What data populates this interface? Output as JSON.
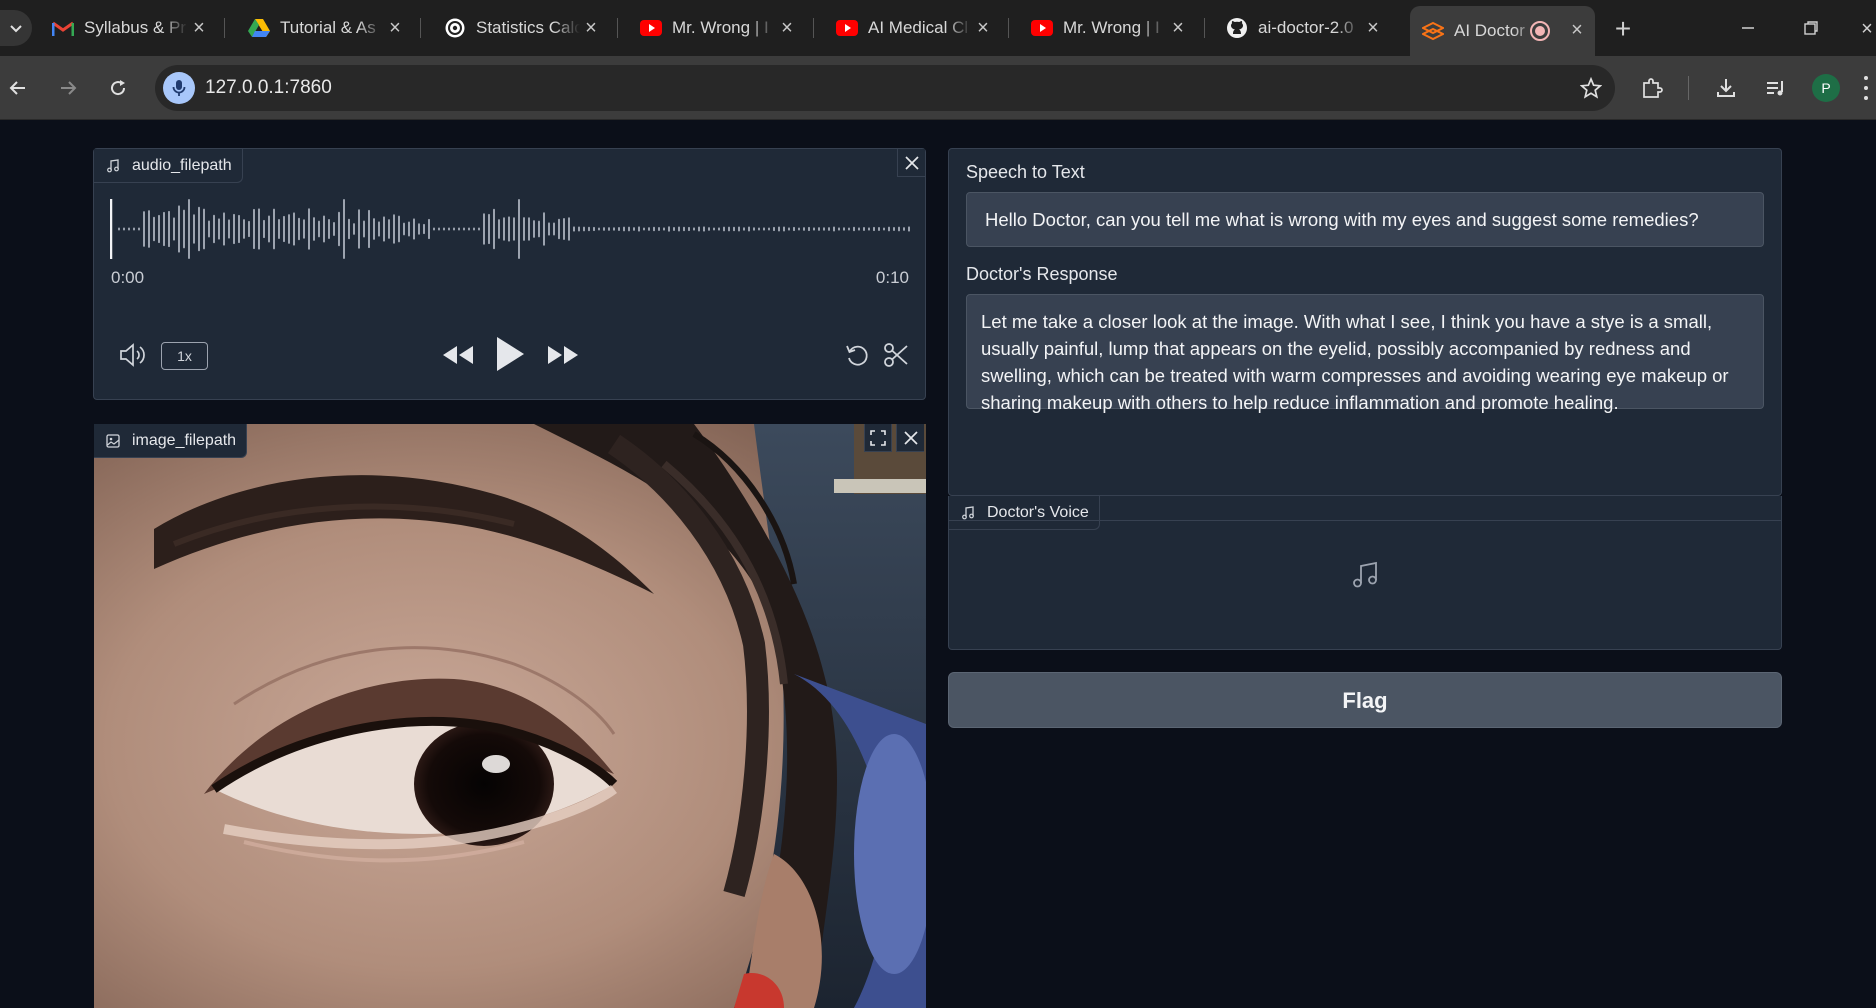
{
  "browser": {
    "tabs": [
      {
        "title": "Syllabus & Pr",
        "icon": "gmail-icon"
      },
      {
        "title": "Tutorial & As",
        "icon": "google-drive-icon"
      },
      {
        "title": "Statistics Calc",
        "icon": "openai-icon"
      },
      {
        "title": "Mr. Wrong | I",
        "icon": "youtube-icon"
      },
      {
        "title": "AI Medical Cl",
        "icon": "youtube-icon"
      },
      {
        "title": "Mr. Wrong | I",
        "icon": "youtube-icon"
      },
      {
        "title": "ai-doctor-2.0",
        "icon": "github-icon"
      },
      {
        "title": "AI Doctor",
        "icon": "gradio-icon",
        "active": true
      }
    ],
    "url": "127.0.0.1:7860",
    "profile_initial": "P"
  },
  "audio_input": {
    "label": "audio_filepath",
    "current_time": "0:00",
    "duration": "0:10",
    "playback_rate": "1x"
  },
  "image_input": {
    "label": "image_filepath"
  },
  "speech_to_text": {
    "label": "Speech to Text",
    "value": "Hello Doctor, can you tell me what is wrong with my eyes and suggest some remedies?"
  },
  "doctor_response": {
    "label": "Doctor's Response",
    "value": "Let me take a closer look at the image. With what I see, I think you have a stye is a small, usually painful, lump that appears on the eyelid, possibly accompanied by redness and swelling, which can be treated with warm compresses and avoiding wearing eye makeup or sharing makeup with others to help reduce inflammation and promote healing."
  },
  "doctor_voice": {
    "label": "Doctor's Voice"
  },
  "flag_button": {
    "label": "Flag"
  },
  "colors": {
    "background": "#0b0f19",
    "block": "#1f2937",
    "border": "#374151",
    "textbox": "#374151",
    "button": "#4b5563"
  }
}
